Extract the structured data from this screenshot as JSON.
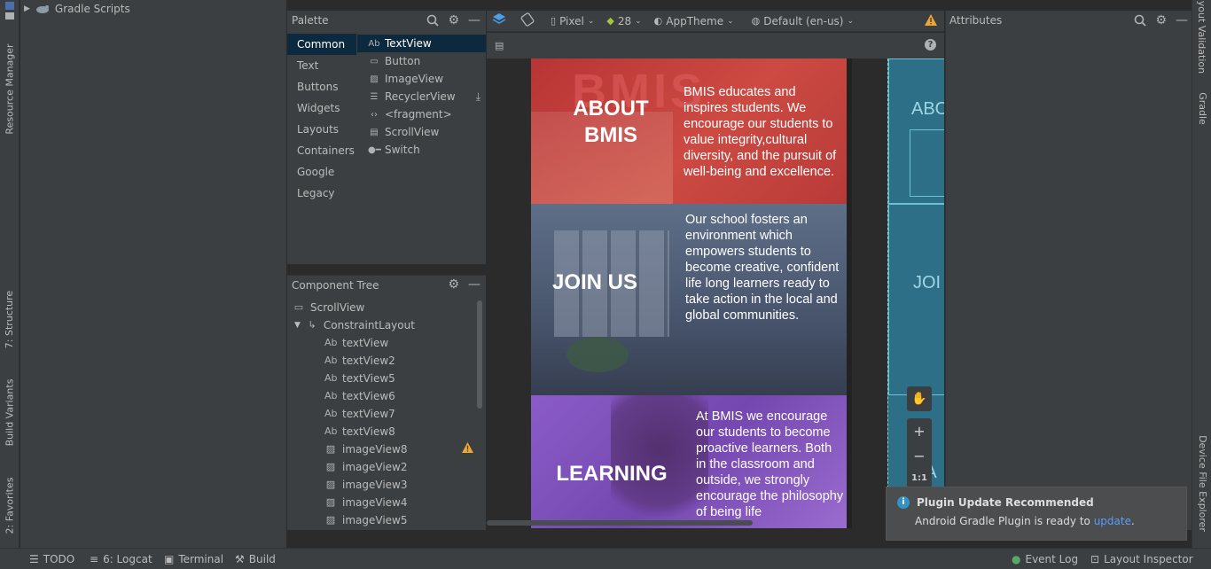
{
  "project": {
    "gradle_scripts": "Gradle Scripts"
  },
  "left_tabs": {
    "resource_manager": "Resource Manager",
    "structure": "7: Structure",
    "build_variants": "Build Variants",
    "favorites": "2: Favorites"
  },
  "right_tabs": {
    "layout_validation": "Layout Validation",
    "gradle": "Gradle",
    "device_file_explorer": "Device File Explorer"
  },
  "palette": {
    "title": "Palette",
    "categories": [
      "Common",
      "Text",
      "Buttons",
      "Widgets",
      "Layouts",
      "Containers",
      "Google",
      "Legacy"
    ],
    "items": [
      {
        "icon": "text-icon",
        "label": "TextView"
      },
      {
        "icon": "button-icon",
        "label": "Button"
      },
      {
        "icon": "image-icon",
        "label": "ImageView"
      },
      {
        "icon": "list-icon",
        "label": "RecyclerView"
      },
      {
        "icon": "code-icon",
        "label": "<fragment>"
      },
      {
        "icon": "scroll-icon",
        "label": "ScrollView"
      },
      {
        "icon": "switch-icon",
        "label": "Switch"
      }
    ]
  },
  "component_tree": {
    "title": "Component Tree",
    "nodes": [
      {
        "label": "ScrollView",
        "depth": 0
      },
      {
        "label": "ConstraintLayout",
        "depth": 1
      },
      {
        "label": "textView",
        "depth": 2
      },
      {
        "label": "textView2",
        "depth": 2
      },
      {
        "label": "textView5",
        "depth": 2
      },
      {
        "label": "textView6",
        "depth": 2
      },
      {
        "label": "textView7",
        "depth": 2
      },
      {
        "label": "textView8",
        "depth": 2
      },
      {
        "label": "imageView8",
        "depth": 2
      },
      {
        "label": "imageView2",
        "depth": 2
      },
      {
        "label": "imageView3",
        "depth": 2
      },
      {
        "label": "imageView4",
        "depth": 2
      },
      {
        "label": "imageView5",
        "depth": 2
      }
    ]
  },
  "toolbar": {
    "device": "Pixel",
    "api": "28",
    "theme": "AppTheme",
    "locale": "Default (en-us)"
  },
  "attributes": {
    "title": "Attributes"
  },
  "design": {
    "sections": [
      {
        "heading": "ABOUT\nBMIS",
        "heading_l1": "ABOUT",
        "heading_l2": "BMIS",
        "text": "BMIS educates and inspires students. We encourage our students to value integrity,cultural diversity, and the pursuit of well-being and excellence.",
        "color": "#c0393a"
      },
      {
        "heading_l1": "JOIN US",
        "text": "Our school fosters an environment which empowers students to become creative, confident life long learners ready to take action in the local and global communities.",
        "color": "#4a5d7a"
      },
      {
        "heading_l1": "LEARNING",
        "text": "At BMIS we encourage our students to become proactive learners. Both in the classroom and outside, we strongly encourage the philosophy of being life",
        "color": "#7e52b8"
      }
    ],
    "blueprint_labels": [
      "ABO",
      "JOI",
      "EA"
    ],
    "zoom_ratio": "1:1"
  },
  "notification": {
    "title": "Plugin Update Recommended",
    "body_prefix": "Android Gradle Plugin is ready to ",
    "link": "update",
    "body_suffix": "."
  },
  "statusbar": {
    "todo": "TODO",
    "logcat": "6: Logcat",
    "terminal": "Terminal",
    "build": "Build",
    "event_log": "Event Log",
    "layout_inspector": "Layout Inspector"
  }
}
